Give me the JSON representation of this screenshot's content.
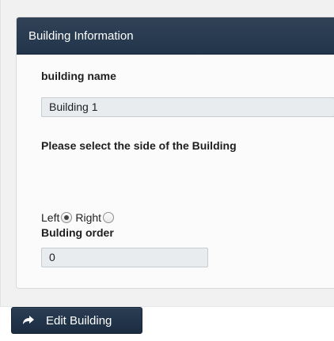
{
  "panel": {
    "title": "Building Information"
  },
  "form": {
    "building_name_label": "building name",
    "building_name_value": "Building 1",
    "side_prompt": "Please select the side of the Building",
    "side_options": [
      {
        "label": "Left",
        "selected": true
      },
      {
        "label": "Right",
        "selected": false
      }
    ],
    "building_order_label": "Bulding order",
    "building_order_value": "0"
  },
  "actions": {
    "edit_button_label": "Edit Building",
    "edit_button_icon": "share-arrow-icon"
  },
  "colors": {
    "header_bg": "#2b3b50",
    "button_bg": "#22354b",
    "input_bg": "#e9ecef"
  }
}
